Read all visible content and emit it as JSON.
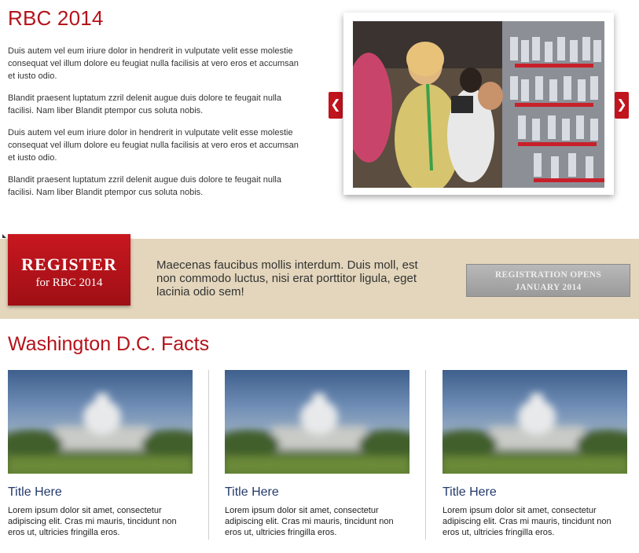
{
  "header": {
    "title": "RBC 2014"
  },
  "intro": {
    "paragraphs": [
      "Duis autem vel eum iriure dolor in hendrerit in vulputate velit esse molestie consequat vel illum dolore eu feugiat nulla facilisis at vero eros et accumsan et iusto odio.",
      "Blandit praesent luptatum zzril delenit augue duis dolore te feugait nulla facilisi. Nam liber Blandit ptempor cus soluta nobis.",
      "Duis autem vel eum iriure dolor in hendrerit in vulputate velit esse molestie consequat vel illum dolore eu feugiat nulla facilisis at vero eros et accumsan et iusto odio.",
      "Blandit praesent luptatum zzril delenit augue duis dolore te feugait nulla facilisi. Nam liber Blandit ptempor cus soluta nobis."
    ]
  },
  "carousel": {
    "prev_icon": "chevron-left-icon",
    "next_icon": "chevron-right-icon"
  },
  "register": {
    "badge_line1": "REGISTER",
    "badge_line2": "for RBC 2014",
    "text": "Maecenas faucibus mollis interdum. Duis moll, est non commodo luctus, nisi erat porttitor ligula, eget lacinia odio sem!",
    "button_line1": "REGISTRATION OPENS",
    "button_line2": "JANUARY 2014"
  },
  "facts": {
    "title": "Washington D.C. Facts",
    "items": [
      {
        "title": "Title Here",
        "text": "Lorem ipsum dolor sit amet, consectetur adipiscing elit. Cras mi mauris, tincidunt non eros ut, ultricies fringilla eros."
      },
      {
        "title": "Title Here",
        "text": "Lorem ipsum dolor sit amet, consectetur adipiscing elit. Cras mi mauris, tincidunt non eros ut, ultricies fringilla eros."
      },
      {
        "title": "Title Here",
        "text": "Lorem ipsum dolor sit amet, consectetur adipiscing elit. Cras mi mauris, tincidunt non eros ut, ultricies fringilla eros."
      }
    ]
  },
  "colors": {
    "accent": "#b5121b",
    "band": "#e3d6bc",
    "link": "#243a6b"
  }
}
